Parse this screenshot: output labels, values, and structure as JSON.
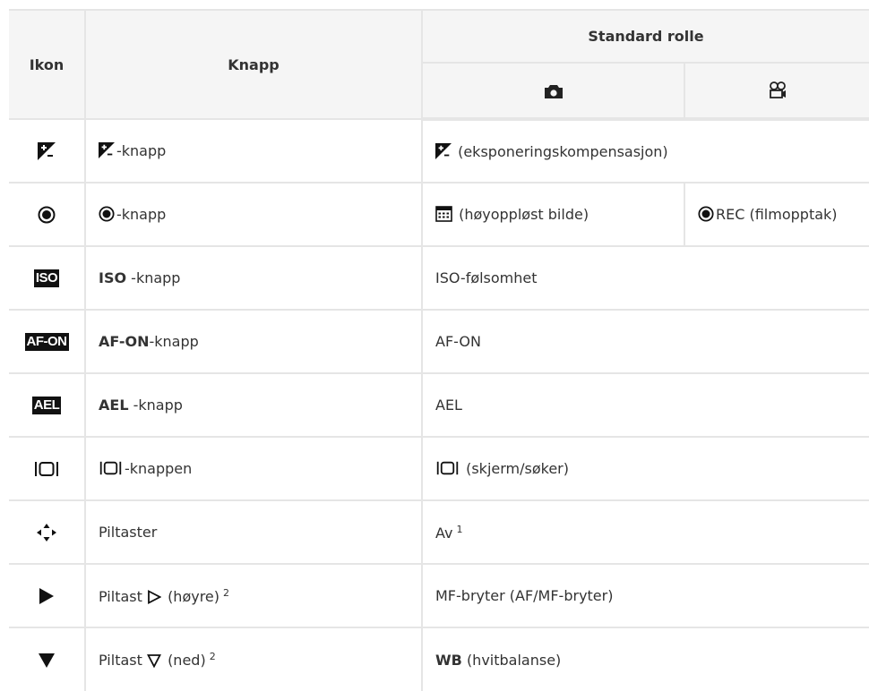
{
  "header": {
    "col_icon": "Ikon",
    "col_button": "Knapp",
    "col_role": "Standard rolle",
    "photo_icon": "camera-icon",
    "video_icon": "movie-camera-icon"
  },
  "rows": [
    {
      "icon": "exposure-compensation-icon",
      "button_suffix": "-knapp",
      "role": "(eksponeringskompensasjon)"
    },
    {
      "icon": "record-icon",
      "button_suffix": "-knapp",
      "role_photo": "(høyoppløst bilde)",
      "role_video": "REC (filmopptak)"
    },
    {
      "icon": "iso-icon",
      "icon_text": "ISO",
      "button_bold": "ISO",
      "button_suffix": " -knapp",
      "role": "ISO-følsomhet"
    },
    {
      "icon": "af-on-icon",
      "icon_text": "AF-ON",
      "button_bold": "AF-ON",
      "button_suffix": "-knapp",
      "role": "AF-ON"
    },
    {
      "icon": "ael-icon",
      "icon_text": "AEL",
      "button_bold": "AEL",
      "button_suffix": " -knapp",
      "role": "AEL"
    },
    {
      "icon": "monitor-viewfinder-icon",
      "button_suffix": "-knappen",
      "role": "(skjerm/søker)"
    },
    {
      "icon": "arrow-pad-icon",
      "button": "Piltaster",
      "role": "Av",
      "role_note": "1"
    },
    {
      "icon": "right-triangle-icon",
      "button": "Piltast",
      "button_paren": "(høyre)",
      "button_note": "2",
      "role": "MF-bryter (AF/MF-bryter)"
    },
    {
      "icon": "down-triangle-icon",
      "button": "Piltast",
      "button_paren": "(ned)",
      "button_note": "2",
      "role_bold": "WB",
      "role": "(hvitbalanse)"
    }
  ]
}
